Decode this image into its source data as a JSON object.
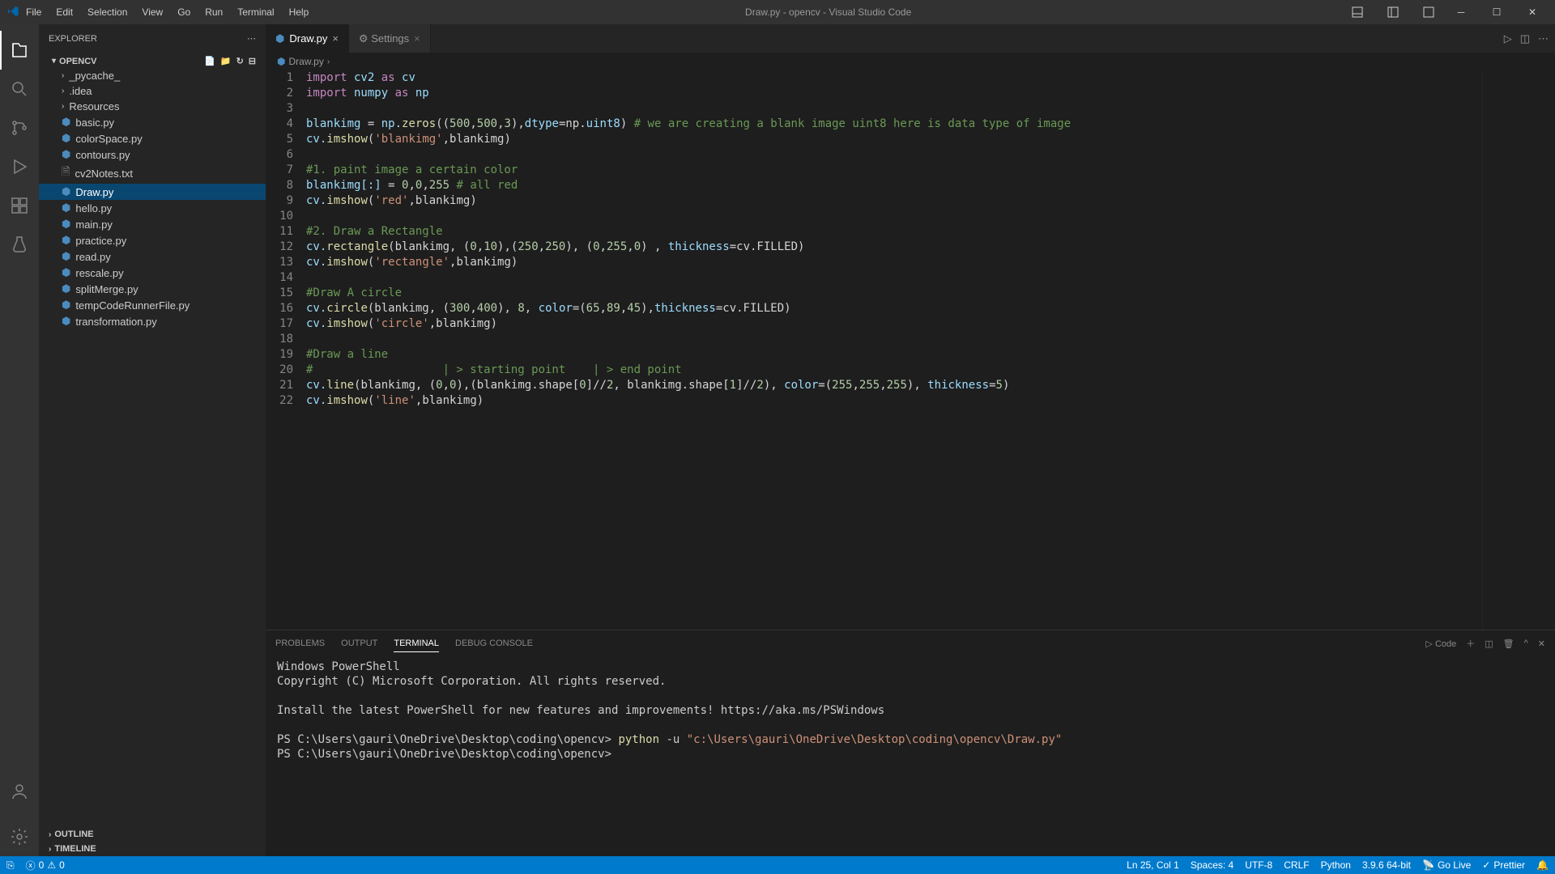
{
  "titlebar": {
    "menus": [
      "File",
      "Edit",
      "Selection",
      "View",
      "Go",
      "Run",
      "Terminal",
      "Help"
    ],
    "title": "Draw.py - opencv - Visual Studio Code"
  },
  "sidebar": {
    "header": "EXPLORER",
    "project": "OPENCV",
    "folders": [
      "_pycache_",
      ".idea",
      "Resources"
    ],
    "files": [
      {
        "name": "basic.py",
        "type": "py"
      },
      {
        "name": "colorSpace.py",
        "type": "py"
      },
      {
        "name": "contours.py",
        "type": "py"
      },
      {
        "name": "cv2Notes.txt",
        "type": "txt"
      },
      {
        "name": "Draw.py",
        "type": "py",
        "selected": true
      },
      {
        "name": "hello.py",
        "type": "py"
      },
      {
        "name": "main.py",
        "type": "py"
      },
      {
        "name": "practice.py",
        "type": "py"
      },
      {
        "name": "read.py",
        "type": "py"
      },
      {
        "name": "rescale.py",
        "type": "py"
      },
      {
        "name": "splitMerge.py",
        "type": "py"
      },
      {
        "name": "tempCodeRunnerFile.py",
        "type": "py"
      },
      {
        "name": "transformation.py",
        "type": "py"
      }
    ],
    "outline": "OUTLINE",
    "timeline": "TIMELINE"
  },
  "tabs": [
    {
      "name": "Draw.py",
      "active": true
    },
    {
      "name": "Settings",
      "active": false,
      "icon": "gear"
    }
  ],
  "breadcrumb": "Draw.py",
  "code": [
    {
      "n": 1,
      "tokens": [
        {
          "t": "import",
          "c": "kw"
        },
        {
          "t": " cv2 ",
          "c": "var"
        },
        {
          "t": "as",
          "c": "kw"
        },
        {
          "t": " cv",
          "c": "var"
        }
      ]
    },
    {
      "n": 2,
      "tokens": [
        {
          "t": "import",
          "c": "kw"
        },
        {
          "t": " numpy ",
          "c": "var"
        },
        {
          "t": "as",
          "c": "kw"
        },
        {
          "t": " np",
          "c": "var"
        }
      ]
    },
    {
      "n": 3,
      "tokens": []
    },
    {
      "n": 4,
      "tokens": [
        {
          "t": "blankimg ",
          "c": "var"
        },
        {
          "t": "=",
          "c": "op"
        },
        {
          "t": " np.",
          "c": "var"
        },
        {
          "t": "zeros",
          "c": "fn"
        },
        {
          "t": "((",
          "c": "op"
        },
        {
          "t": "500",
          "c": "num"
        },
        {
          "t": ",",
          "c": "op"
        },
        {
          "t": "500",
          "c": "num"
        },
        {
          "t": ",",
          "c": "op"
        },
        {
          "t": "3",
          "c": "num"
        },
        {
          "t": "),",
          "c": "op"
        },
        {
          "t": "dtype",
          "c": "var"
        },
        {
          "t": "=np.",
          "c": "op"
        },
        {
          "t": "uint8",
          "c": "var"
        },
        {
          "t": ") ",
          "c": "op"
        },
        {
          "t": "# we are creating a blank image uint8 here is data type of image",
          "c": "com"
        }
      ]
    },
    {
      "n": 5,
      "tokens": [
        {
          "t": "cv.",
          "c": "var"
        },
        {
          "t": "imshow",
          "c": "fn"
        },
        {
          "t": "(",
          "c": "op"
        },
        {
          "t": "'blankimg'",
          "c": "str"
        },
        {
          "t": ",blankimg)",
          "c": "op"
        }
      ]
    },
    {
      "n": 6,
      "tokens": []
    },
    {
      "n": 7,
      "tokens": [
        {
          "t": "#1. paint image a certain color",
          "c": "com"
        }
      ]
    },
    {
      "n": 8,
      "tokens": [
        {
          "t": "blankimg[:] ",
          "c": "var"
        },
        {
          "t": "=",
          "c": "op"
        },
        {
          "t": " ",
          "c": "op"
        },
        {
          "t": "0",
          "c": "num"
        },
        {
          "t": ",",
          "c": "op"
        },
        {
          "t": "0",
          "c": "num"
        },
        {
          "t": ",",
          "c": "op"
        },
        {
          "t": "255",
          "c": "num"
        },
        {
          "t": " # all red",
          "c": "com"
        }
      ]
    },
    {
      "n": 9,
      "tokens": [
        {
          "t": "cv.",
          "c": "var"
        },
        {
          "t": "imshow",
          "c": "fn"
        },
        {
          "t": "(",
          "c": "op"
        },
        {
          "t": "'red'",
          "c": "str"
        },
        {
          "t": ",blankimg)",
          "c": "op"
        }
      ]
    },
    {
      "n": 10,
      "tokens": []
    },
    {
      "n": 11,
      "tokens": [
        {
          "t": "#2. Draw a Rectangle",
          "c": "com"
        }
      ]
    },
    {
      "n": 12,
      "tokens": [
        {
          "t": "cv.",
          "c": "var"
        },
        {
          "t": "rectangle",
          "c": "fn"
        },
        {
          "t": "(blankimg, (",
          "c": "op"
        },
        {
          "t": "0",
          "c": "num"
        },
        {
          "t": ",",
          "c": "op"
        },
        {
          "t": "10",
          "c": "num"
        },
        {
          "t": "),(",
          "c": "op"
        },
        {
          "t": "250",
          "c": "num"
        },
        {
          "t": ",",
          "c": "op"
        },
        {
          "t": "250",
          "c": "num"
        },
        {
          "t": "), (",
          "c": "op"
        },
        {
          "t": "0",
          "c": "num"
        },
        {
          "t": ",",
          "c": "op"
        },
        {
          "t": "255",
          "c": "num"
        },
        {
          "t": ",",
          "c": "op"
        },
        {
          "t": "0",
          "c": "num"
        },
        {
          "t": ") , ",
          "c": "op"
        },
        {
          "t": "thickness",
          "c": "var"
        },
        {
          "t": "=cv.FILLED)",
          "c": "op"
        }
      ]
    },
    {
      "n": 13,
      "tokens": [
        {
          "t": "cv.",
          "c": "var"
        },
        {
          "t": "imshow",
          "c": "fn"
        },
        {
          "t": "(",
          "c": "op"
        },
        {
          "t": "'rectangle'",
          "c": "str"
        },
        {
          "t": ",blankimg)",
          "c": "op"
        }
      ]
    },
    {
      "n": 14,
      "tokens": []
    },
    {
      "n": 15,
      "tokens": [
        {
          "t": "#Draw A circle",
          "c": "com"
        }
      ]
    },
    {
      "n": 16,
      "tokens": [
        {
          "t": "cv.",
          "c": "var"
        },
        {
          "t": "circle",
          "c": "fn"
        },
        {
          "t": "(blankimg, (",
          "c": "op"
        },
        {
          "t": "300",
          "c": "num"
        },
        {
          "t": ",",
          "c": "op"
        },
        {
          "t": "400",
          "c": "num"
        },
        {
          "t": "), ",
          "c": "op"
        },
        {
          "t": "8",
          "c": "num"
        },
        {
          "t": ", ",
          "c": "op"
        },
        {
          "t": "color",
          "c": "var"
        },
        {
          "t": "=(",
          "c": "op"
        },
        {
          "t": "65",
          "c": "num"
        },
        {
          "t": ",",
          "c": "op"
        },
        {
          "t": "89",
          "c": "num"
        },
        {
          "t": ",",
          "c": "op"
        },
        {
          "t": "45",
          "c": "num"
        },
        {
          "t": "),",
          "c": "op"
        },
        {
          "t": "thickness",
          "c": "var"
        },
        {
          "t": "=cv.FILLED)",
          "c": "op"
        }
      ]
    },
    {
      "n": 17,
      "tokens": [
        {
          "t": "cv.",
          "c": "var"
        },
        {
          "t": "imshow",
          "c": "fn"
        },
        {
          "t": "(",
          "c": "op"
        },
        {
          "t": "'circle'",
          "c": "str"
        },
        {
          "t": ",blankimg)",
          "c": "op"
        }
      ]
    },
    {
      "n": 18,
      "tokens": []
    },
    {
      "n": 19,
      "tokens": [
        {
          "t": "#Draw a line",
          "c": "com"
        }
      ]
    },
    {
      "n": 20,
      "tokens": [
        {
          "t": "#                   | > starting point    | > end point",
          "c": "com"
        }
      ]
    },
    {
      "n": 21,
      "tokens": [
        {
          "t": "cv.",
          "c": "var"
        },
        {
          "t": "line",
          "c": "fn"
        },
        {
          "t": "(blankimg, (",
          "c": "op"
        },
        {
          "t": "0",
          "c": "num"
        },
        {
          "t": ",",
          "c": "op"
        },
        {
          "t": "0",
          "c": "num"
        },
        {
          "t": "),(blankimg.shape[",
          "c": "op"
        },
        {
          "t": "0",
          "c": "num"
        },
        {
          "t": "]//",
          "c": "op"
        },
        {
          "t": "2",
          "c": "num"
        },
        {
          "t": ", blankimg.shape[",
          "c": "op"
        },
        {
          "t": "1",
          "c": "num"
        },
        {
          "t": "]//",
          "c": "op"
        },
        {
          "t": "2",
          "c": "num"
        },
        {
          "t": "), ",
          "c": "op"
        },
        {
          "t": "color",
          "c": "var"
        },
        {
          "t": "=(",
          "c": "op"
        },
        {
          "t": "255",
          "c": "num"
        },
        {
          "t": ",",
          "c": "op"
        },
        {
          "t": "255",
          "c": "num"
        },
        {
          "t": ",",
          "c": "op"
        },
        {
          "t": "255",
          "c": "num"
        },
        {
          "t": "), ",
          "c": "op"
        },
        {
          "t": "thickness",
          "c": "var"
        },
        {
          "t": "=",
          "c": "op"
        },
        {
          "t": "5",
          "c": "num"
        },
        {
          "t": ")",
          "c": "op"
        }
      ]
    },
    {
      "n": 22,
      "tokens": [
        {
          "t": "cv.",
          "c": "var"
        },
        {
          "t": "imshow",
          "c": "fn"
        },
        {
          "t": "(",
          "c": "op"
        },
        {
          "t": "'line'",
          "c": "str"
        },
        {
          "t": ",blankimg)",
          "c": "op"
        }
      ]
    }
  ],
  "panel": {
    "tabs": [
      "PROBLEMS",
      "OUTPUT",
      "TERMINAL",
      "DEBUG CONSOLE"
    ],
    "active": "TERMINAL",
    "shell_label": "Code",
    "terminal": {
      "line1": "Windows PowerShell",
      "line2": "Copyright (C) Microsoft Corporation. All rights reserved.",
      "line3": "Install the latest PowerShell for new features and improvements! https://aka.ms/PSWindows",
      "prompt1": "PS C:\\Users\\gauri\\OneDrive\\Desktop\\coding\\opencv> ",
      "cmd": "python",
      "args": " -u ",
      "path": "\"c:\\Users\\gauri\\OneDrive\\Desktop\\coding\\opencv\\Draw.py\"",
      "prompt2": "PS C:\\Users\\gauri\\OneDrive\\Desktop\\coding\\opencv>"
    }
  },
  "statusbar": {
    "errors": "0",
    "warnings": "0",
    "cursor": "Ln 25, Col 1",
    "spaces": "Spaces: 4",
    "encoding": "UTF-8",
    "eol": "CRLF",
    "lang": "Python",
    "interpreter": "3.9.6 64-bit",
    "golive": "Go Live",
    "prettier": "Prettier",
    "bell": ""
  }
}
